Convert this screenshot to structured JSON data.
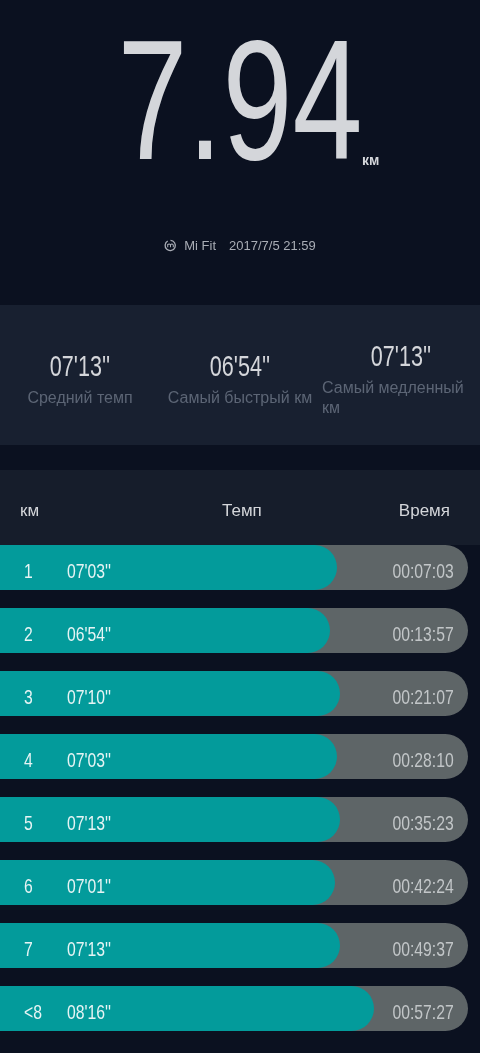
{
  "distance": {
    "value": "7.94",
    "unit": "км"
  },
  "source": {
    "app": "Mi Fit",
    "datetime": "2017/7/5 21:59"
  },
  "stats": [
    {
      "value": "07'13''",
      "label": "Средний темп"
    },
    {
      "value": "06'54''",
      "label": "Самый быстрый км"
    },
    {
      "value": "07'13''",
      "label": "Самый медленный км"
    }
  ],
  "table": {
    "columns": [
      "км",
      "Темп",
      "Время"
    ],
    "rows": [
      {
        "km": "1",
        "pace": "07'03''",
        "time": "00:07:03",
        "level": 0.72
      },
      {
        "km": "2",
        "pace": "06'54''",
        "time": "00:13:57",
        "level": 0.705
      },
      {
        "km": "3",
        "pace": "07'10''",
        "time": "00:21:07",
        "level": 0.726
      },
      {
        "km": "4",
        "pace": "07'03''",
        "time": "00:28:10",
        "level": 0.72
      },
      {
        "km": "5",
        "pace": "07'13''",
        "time": "00:35:23",
        "level": 0.727
      },
      {
        "km": "6",
        "pace": "07'01''",
        "time": "00:42:24",
        "level": 0.716
      },
      {
        "km": "7",
        "pace": "07'13''",
        "time": "00:49:37",
        "level": 0.727
      },
      {
        "km": "<8",
        "pace": "08'16''",
        "time": "00:57:27",
        "level": 0.8
      }
    ]
  }
}
